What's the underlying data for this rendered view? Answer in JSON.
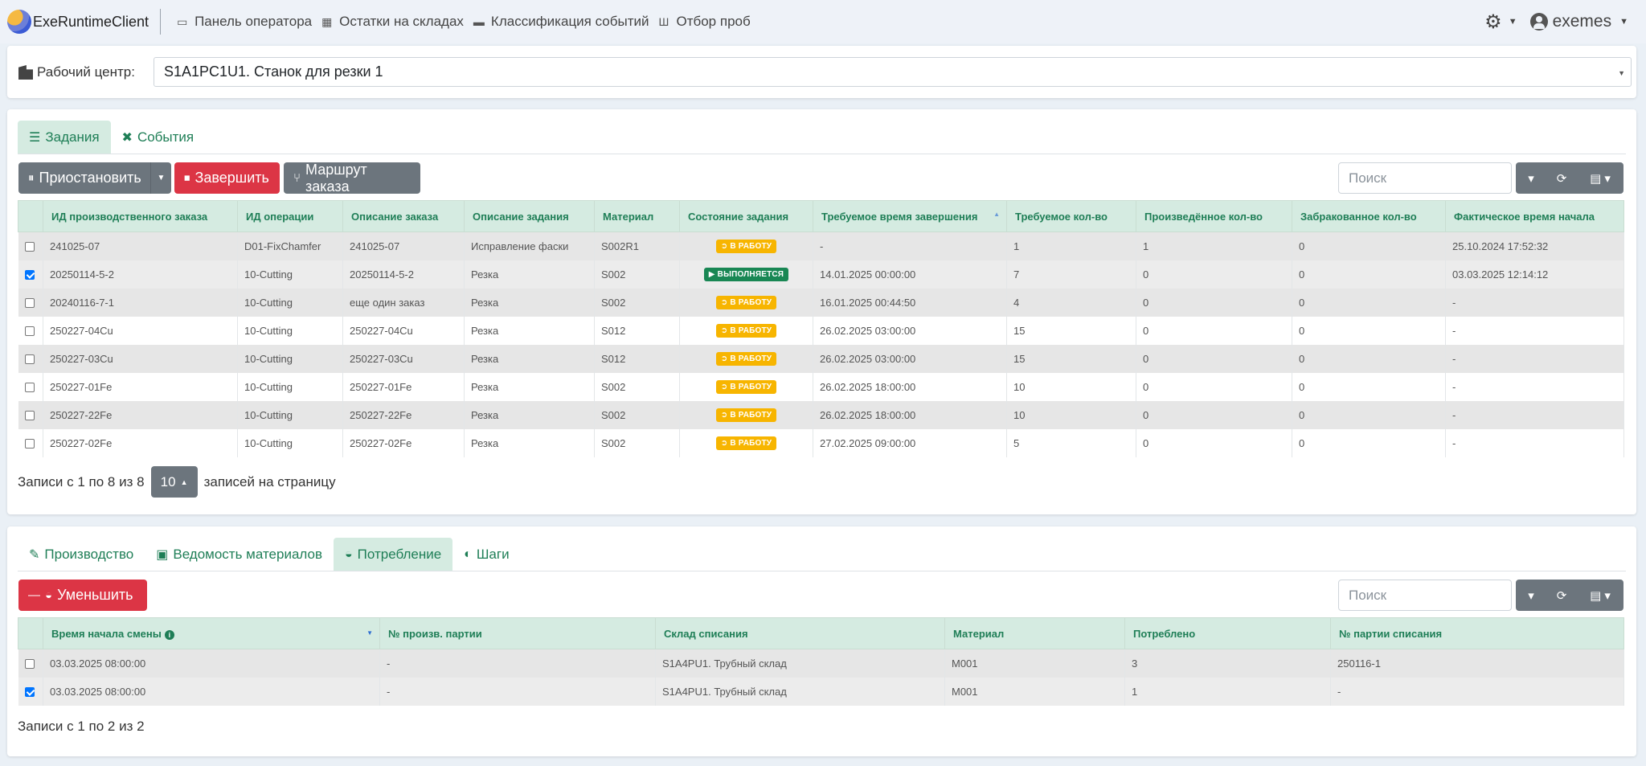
{
  "navbar": {
    "brand": "ExeRuntimeClient",
    "links": [
      {
        "label": "Панель оператора",
        "icon": "operator-panel-icon"
      },
      {
        "label": "Остатки на складах",
        "icon": "warehouse-icon"
      },
      {
        "label": "Классификация событий",
        "icon": "briefcase-icon"
      },
      {
        "label": "Отбор проб",
        "icon": "vials-icon"
      }
    ],
    "user": "exemes"
  },
  "workcenter": {
    "label": "Рабочий центр:",
    "value": "S1A1PC1U1. Станок для резки 1"
  },
  "tasks_panel": {
    "tabs": [
      "Задания",
      "События"
    ],
    "buttons": {
      "pause": "Приостановить",
      "finish": "Завершить",
      "route": "Маршрут заказа"
    },
    "search_placeholder": "Поиск",
    "columns": [
      "ИД производственного заказа",
      "ИД операции",
      "Описание заказа",
      "Описание задания",
      "Материал",
      "Состояние задания",
      "Требуемое время завершения",
      "Требуемое кол-во",
      "Произведённое кол-во",
      "Забракованное кол-во",
      "Фактическое время начала"
    ],
    "rows": [
      {
        "checked": false,
        "order": "241025-07",
        "op": "D01-FixChamfer",
        "order_desc": "241025-07",
        "task_desc": "Исправление фаски",
        "material": "S002R1",
        "state": "В РАБОТУ",
        "due": "-",
        "req": "1",
        "prod": "1",
        "rej": "0",
        "start": "25.10.2024 17:52:32"
      },
      {
        "checked": true,
        "order": "20250114-5-2",
        "op": "10-Cutting",
        "order_desc": "20250114-5-2",
        "task_desc": "Резка",
        "material": "S002",
        "state": "ВЫПОЛНЯЕТСЯ",
        "due": "14.01.2025 00:00:00",
        "req": "7",
        "prod": "0",
        "rej": "0",
        "start": "03.03.2025 12:14:12"
      },
      {
        "checked": false,
        "order": "20240116-7-1",
        "op": "10-Cutting",
        "order_desc": "еще один заказ",
        "task_desc": "Резка",
        "material": "S002",
        "state": "В РАБОТУ",
        "due": "16.01.2025 00:44:50",
        "req": "4",
        "prod": "0",
        "rej": "0",
        "start": "-"
      },
      {
        "checked": false,
        "order": "250227-04Cu",
        "op": "10-Cutting",
        "order_desc": "250227-04Cu",
        "task_desc": "Резка",
        "material": "S012",
        "state": "В РАБОТУ",
        "due": "26.02.2025 03:00:00",
        "req": "15",
        "prod": "0",
        "rej": "0",
        "start": "-"
      },
      {
        "checked": false,
        "order": "250227-03Cu",
        "op": "10-Cutting",
        "order_desc": "250227-03Cu",
        "task_desc": "Резка",
        "material": "S012",
        "state": "В РАБОТУ",
        "due": "26.02.2025 03:00:00",
        "req": "15",
        "prod": "0",
        "rej": "0",
        "start": "-"
      },
      {
        "checked": false,
        "order": "250227-01Fe",
        "op": "10-Cutting",
        "order_desc": "250227-01Fe",
        "task_desc": "Резка",
        "material": "S002",
        "state": "В РАБОТУ",
        "due": "26.02.2025 18:00:00",
        "req": "10",
        "prod": "0",
        "rej": "0",
        "start": "-"
      },
      {
        "checked": false,
        "order": "250227-22Fe",
        "op": "10-Cutting",
        "order_desc": "250227-22Fe",
        "task_desc": "Резка",
        "material": "S002",
        "state": "В РАБОТУ",
        "due": "26.02.2025 18:00:00",
        "req": "10",
        "prod": "0",
        "rej": "0",
        "start": "-"
      },
      {
        "checked": false,
        "order": "250227-02Fe",
        "op": "10-Cutting",
        "order_desc": "250227-02Fe",
        "task_desc": "Резка",
        "material": "S002",
        "state": "В РАБОТУ",
        "due": "27.02.2025 09:00:00",
        "req": "5",
        "prod": "0",
        "rej": "0",
        "start": "-"
      }
    ],
    "pager": {
      "info": "Записи с 1 по 8 из 8",
      "page_size": "10",
      "suffix": "записей на страницу"
    }
  },
  "bottom_panel": {
    "tabs": [
      "Производство",
      "Ведомость материалов",
      "Потребление",
      "Шаги"
    ],
    "buttons": {
      "reduce": "Уменьшить"
    },
    "search_placeholder": "Поиск",
    "columns": [
      "Время начала смены",
      "№ произв. партии",
      "Склад списания",
      "Материал",
      "Потреблено",
      "№ партии списания"
    ],
    "rows": [
      {
        "checked": false,
        "shift": "03.03.2025 08:00:00",
        "batch": "-",
        "wh": "S1A4PU1. Трубный склад",
        "material": "M001",
        "qty": "3",
        "lot": "250116-1"
      },
      {
        "checked": true,
        "shift": "03.03.2025 08:00:00",
        "batch": "-",
        "wh": "S1A4PU1. Трубный склад",
        "material": "M001",
        "qty": "1",
        "lot": "-"
      }
    ],
    "pager": {
      "info": "Записи с 1 по 2 из 2"
    }
  },
  "colors": {
    "accent": "#1e7e56",
    "header_bg": "#d5ebe1",
    "danger": "#dc3545",
    "secondary": "#6c757d",
    "warning": "#f7b500",
    "success": "#198754"
  }
}
